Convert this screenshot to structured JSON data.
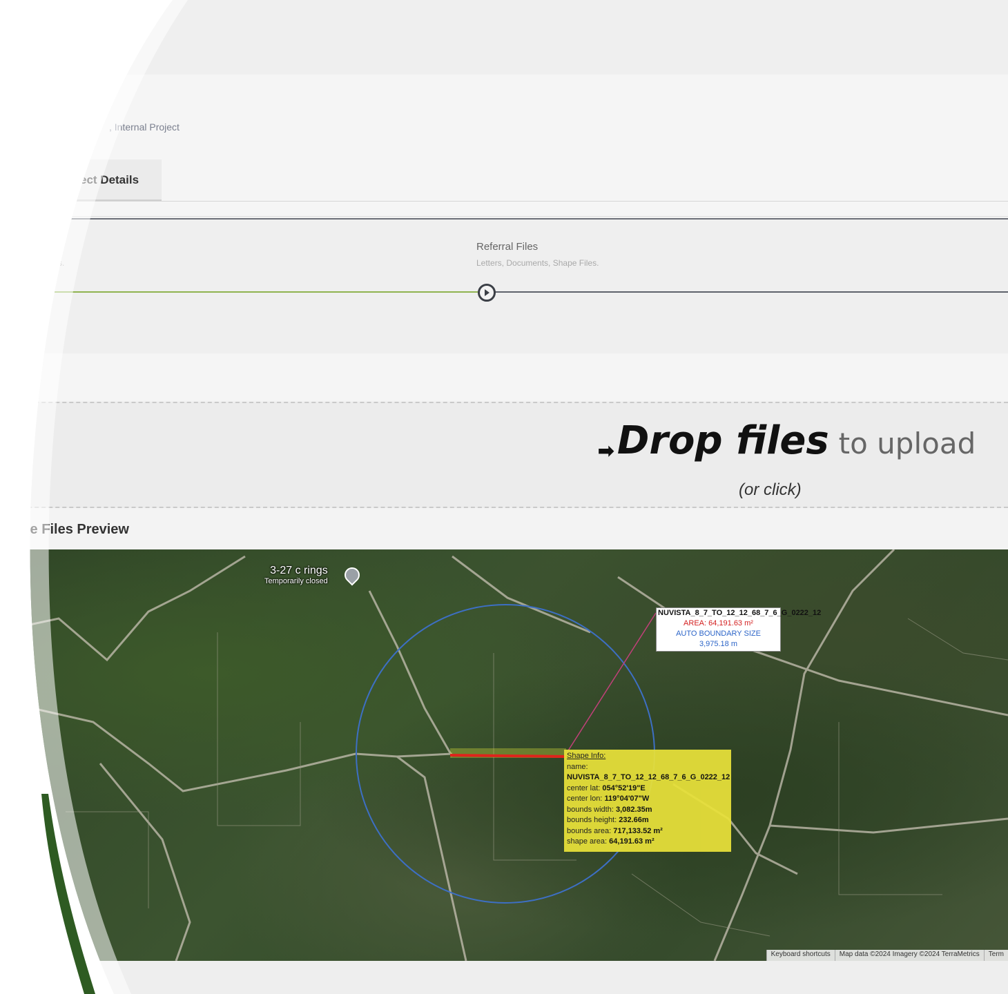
{
  "breadcrumb": {
    "text": ", Internal Project"
  },
  "tabs": [
    {
      "label": "ect Details"
    }
  ],
  "stepper": {
    "prev_sub": "s.",
    "current_title": "Referral Files",
    "current_sub": "Letters, Documents, Shape Files."
  },
  "dropzone": {
    "arrow": "➡",
    "main_bold": "Drop files",
    "main_light": "to upload",
    "sub": "(or click)"
  },
  "preview": {
    "title": "hape Files Preview"
  },
  "map": {
    "place_name": "3-27 c rings",
    "place_status": "Temporarily closed",
    "label_box": {
      "name": "NUVISTA_8_7_TO_12_12_68_7_6_G_0222_12",
      "area": "AREA: 64,191.63 m²",
      "auto_boundary": "AUTO BOUNDARY SIZE",
      "boundary_value": "3,975.18 m"
    },
    "shape_info": {
      "heading": "Shape Info:",
      "name_label": "name:",
      "name_value": "NUVISTA_8_7_TO_12_12_68_7_6_G_0222_12",
      "center_lat_label": "center lat:",
      "center_lat_value": "054°52'19\"E",
      "center_lon_label": "center lon:",
      "center_lon_value": "119°04'07\"W",
      "bounds_width_label": "bounds width:",
      "bounds_width_value": "3,082.35m",
      "bounds_height_label": "bounds height:",
      "bounds_height_value": "232.66m",
      "bounds_area_label": "bounds area:",
      "bounds_area_value": "717,133.52 m²",
      "shape_area_label": "shape area:",
      "shape_area_value": "64,191.63 m²"
    },
    "attribution": {
      "shortcuts": "Keyboard shortcuts",
      "data": "Map data ©2024 Imagery ©2024 TerraMetrics",
      "terms": "Term"
    },
    "colors": {
      "circle": "#3d6fc4",
      "shape_line": "#e0241c",
      "leader_line": "#c2407a",
      "info_fill": "#e9e23a",
      "stepper_done": "#8fb34f"
    }
  }
}
